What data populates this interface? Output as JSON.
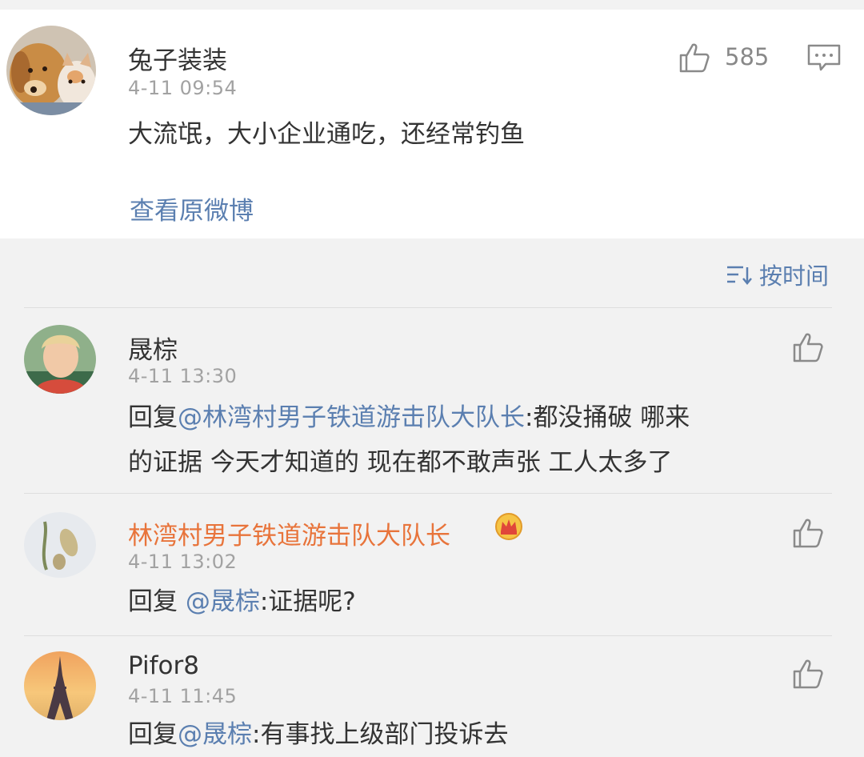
{
  "post": {
    "author": "兔子装装",
    "time": "4-11 09:54",
    "text": "大流氓，大小企业通吃，还经常钓鱼",
    "likes": "585",
    "view_original": "查看原微博"
  },
  "sort": {
    "label": "按时间",
    "icon": "sort-lines-icon"
  },
  "comments": [
    {
      "author": "晟棕",
      "time": "4-11 13:30",
      "reply_prefix": "回复",
      "mention": "@林湾村男子铁道游击队大队长",
      "text_line1": ":都没捅破 哪来",
      "text_line2": "的证据 今天才知道的 现在都不敢声张 工人太多了"
    },
    {
      "author": "林湾村男子铁道游击队大队长",
      "author_color": "#e8743b",
      "badge": "crown-icon",
      "time": "4-11 13:02",
      "reply_prefix": "回复 ",
      "mention": "@晟棕",
      "text_line1": ":证据呢?"
    },
    {
      "author": "Pifor8",
      "time": "4-11 11:45",
      "reply_prefix": "回复",
      "mention": "@晟棕",
      "text_line1": ":有事找上级部门投诉去"
    }
  ],
  "colors": {
    "link": "#5b7fb0",
    "vip_name": "#e8743b",
    "time": "#a2a2a2",
    "bg": "#f2f2f2"
  }
}
